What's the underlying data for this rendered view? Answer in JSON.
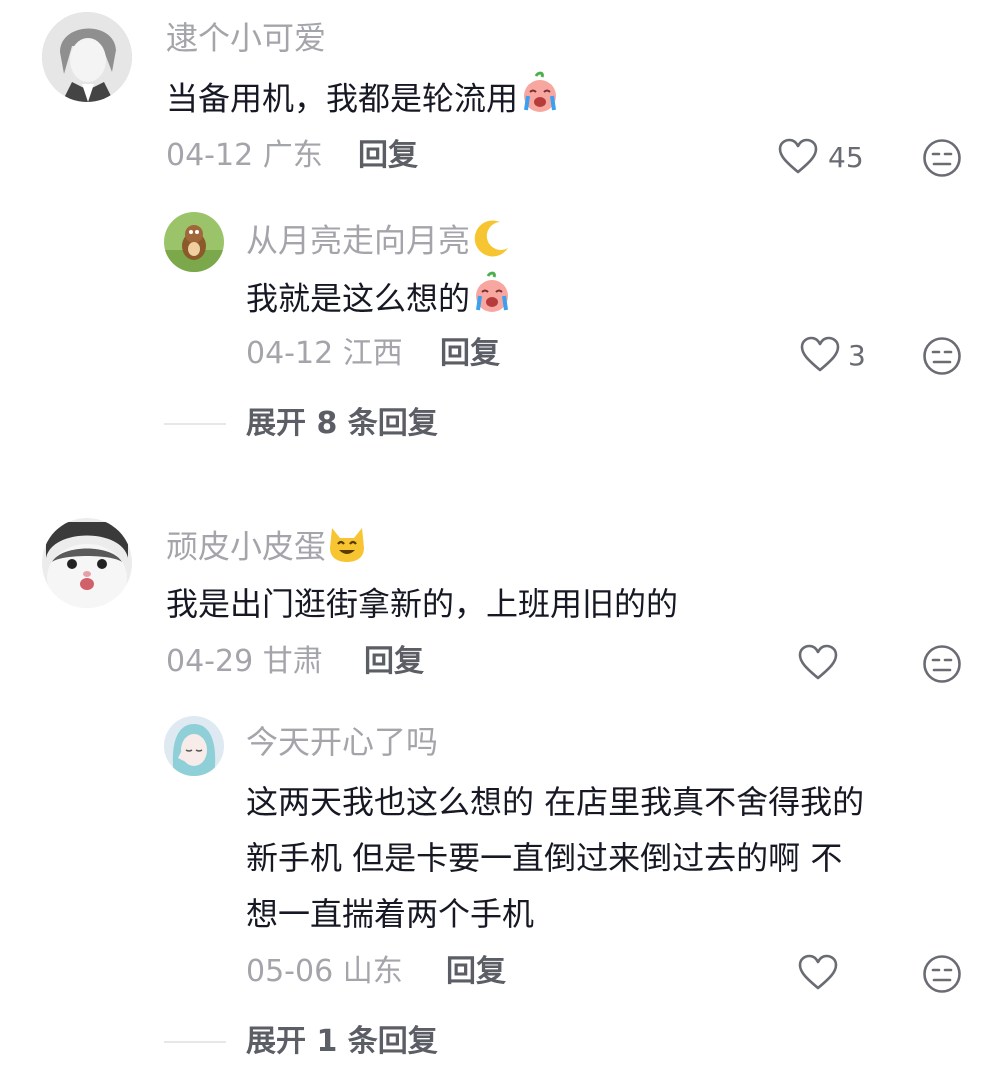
{
  "comments": [
    {
      "username": "逮个小可爱",
      "text": "当备用机，我都是轮流用",
      "date": "04-12",
      "location": "广东",
      "reply_label": "回复",
      "likes": "45",
      "emoji": "crying-laughing-peach-emoji",
      "replies": [
        {
          "username": "从月亮走向月亮",
          "username_emoji": "crescent-moon-emoji",
          "text": "我就是这么想的",
          "text_emoji": "crying-laughing-peach-emoji",
          "date": "04-12",
          "location": "江西",
          "reply_label": "回复",
          "likes": "3"
        }
      ],
      "expand_label": "展开 8 条回复"
    },
    {
      "username": "顽皮小皮蛋",
      "username_emoji": "smiling-cat-emoji",
      "text": "我是出门逛街拿新的，上班用旧的的",
      "date": "04-29",
      "location": "甘肃",
      "reply_label": "回复",
      "likes": "",
      "replies": [
        {
          "username": "今天开心了吗",
          "text_lines": [
            "这两天我也这么想的  在店里我真不舍得我的",
            "新手机  但是卡要一直倒过来倒过去的啊  不",
            "想一直揣着两个手机"
          ],
          "date": "05-06",
          "location": "山东",
          "reply_label": "回复",
          "likes": ""
        }
      ],
      "expand_label": "展开 1 条回复"
    }
  ],
  "icons": {
    "like": "heart-outline-icon",
    "dislike": "meh-face-icon"
  },
  "colors": {
    "username": "#a3a5ab",
    "text": "#161823",
    "meta": "#a3a5ab",
    "reply": "#5c5e66"
  }
}
